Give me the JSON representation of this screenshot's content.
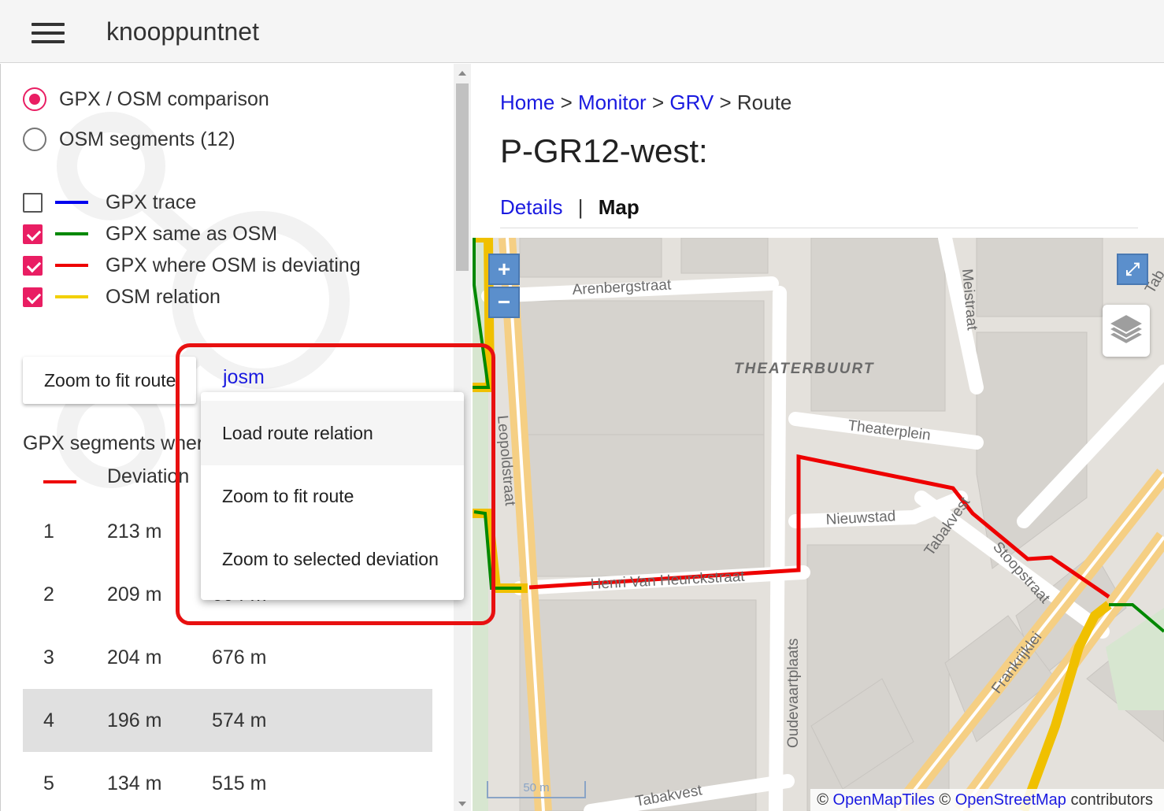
{
  "app": {
    "title": "knooppuntnet"
  },
  "sidebar": {
    "radios": [
      {
        "label": "GPX / OSM comparison",
        "selected": true
      },
      {
        "label": "OSM segments (12)",
        "selected": false
      }
    ],
    "layers": [
      {
        "label": "GPX trace",
        "checked": false,
        "color": "#0000ee"
      },
      {
        "label": "GPX same as OSM",
        "checked": true,
        "color": "#008800"
      },
      {
        "label": "GPX where OSM is deviating",
        "checked": true,
        "color": "#ee0000"
      },
      {
        "label": "OSM relation",
        "checked": true,
        "color": "#f2d000"
      }
    ],
    "zoom_button": "Zoom to fit route",
    "josm_link": "josm",
    "segments_title": "GPX segments where OSM is deviating",
    "deviation_header": "Deviation",
    "segments": [
      {
        "index": "1",
        "deviation": "213 m",
        "length": ""
      },
      {
        "index": "2",
        "deviation": "209 m",
        "length": "604 m"
      },
      {
        "index": "3",
        "deviation": "204 m",
        "length": "676 m"
      },
      {
        "index": "4",
        "deviation": "196 m",
        "length": "574 m",
        "selected": true
      },
      {
        "index": "5",
        "deviation": "134 m",
        "length": "515 m"
      }
    ]
  },
  "josm_menu": {
    "items": [
      "Load route relation",
      "Zoom to fit route",
      "Zoom to selected deviation"
    ]
  },
  "breadcrumb": {
    "home": "Home",
    "monitor": "Monitor",
    "group": "GRV",
    "current": "Route",
    "separator": ">"
  },
  "page_title": "P-GR12-west:",
  "tabs": {
    "details": "Details",
    "separator": "|",
    "map": "Map"
  },
  "map": {
    "zoom_in": "+",
    "zoom_out": "−",
    "scale_label": "50 m",
    "streets": [
      "Arenbergstraat",
      "THEATERBUURT",
      "Theaterplein",
      "Nieuwstad",
      "Leopoldstraat",
      "Meistraat",
      "Henri Van Heurckstraat",
      "Oudevaartplaats",
      "Tabakvest",
      "Stoopstraat",
      "Frankrijklei",
      "Tabakvest",
      "Tab"
    ],
    "attribution": {
      "sym1": "©",
      "openmaptiles": "OpenMapTiles",
      "sym2": "©",
      "openstreetmap": "OpenStreetMap",
      "contributors": "contributors"
    }
  }
}
